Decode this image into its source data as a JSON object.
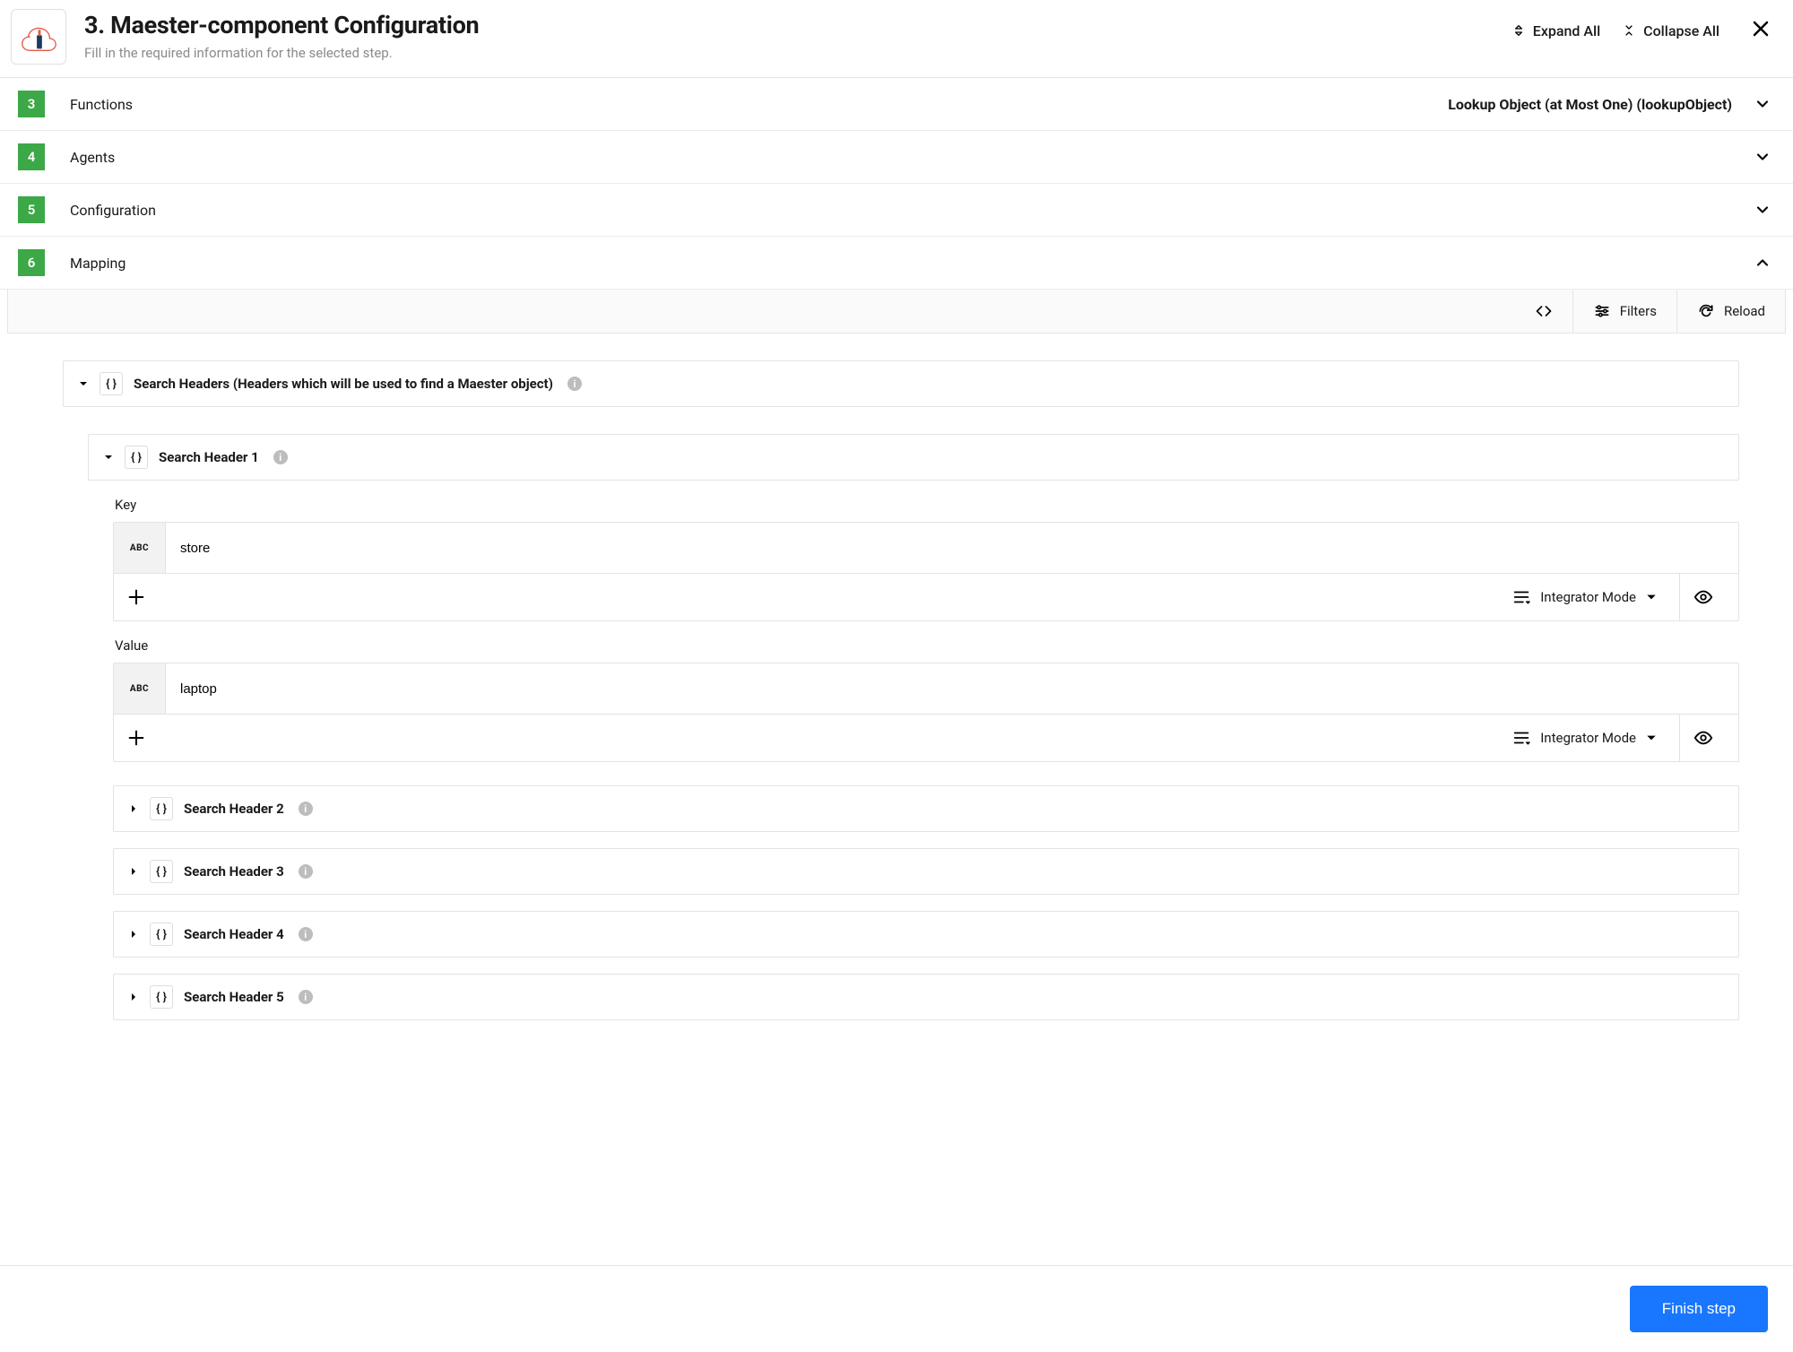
{
  "header": {
    "title": "3. Maester-component Configuration",
    "subtitle": "Fill in the required information for the selected step.",
    "expand_all": "Expand All",
    "collapse_all": "Collapse All"
  },
  "sections": [
    {
      "num": "3",
      "label": "Functions",
      "summary": "Lookup Object (at Most One) (lookupObject)",
      "expanded": false
    },
    {
      "num": "4",
      "label": "Agents",
      "summary": "",
      "expanded": false
    },
    {
      "num": "5",
      "label": "Configuration",
      "summary": "",
      "expanded": false
    },
    {
      "num": "6",
      "label": "Mapping",
      "summary": "",
      "expanded": true
    }
  ],
  "toolbar": {
    "filters": "Filters",
    "reload": "Reload"
  },
  "mapping": {
    "search_headers_title": "Search Headers (Headers which will be used to find a Maester object)",
    "header1": {
      "title": "Search Header 1",
      "key_label": "Key",
      "key_value": "store",
      "value_label": "Value",
      "value_value": "laptop"
    },
    "collapsed_headers": [
      "Search Header 2",
      "Search Header 3",
      "Search Header 4",
      "Search Header 5"
    ],
    "abc_badge": "ABC",
    "mode_label": "Integrator Mode"
  },
  "footer": {
    "finish": "Finish step"
  }
}
